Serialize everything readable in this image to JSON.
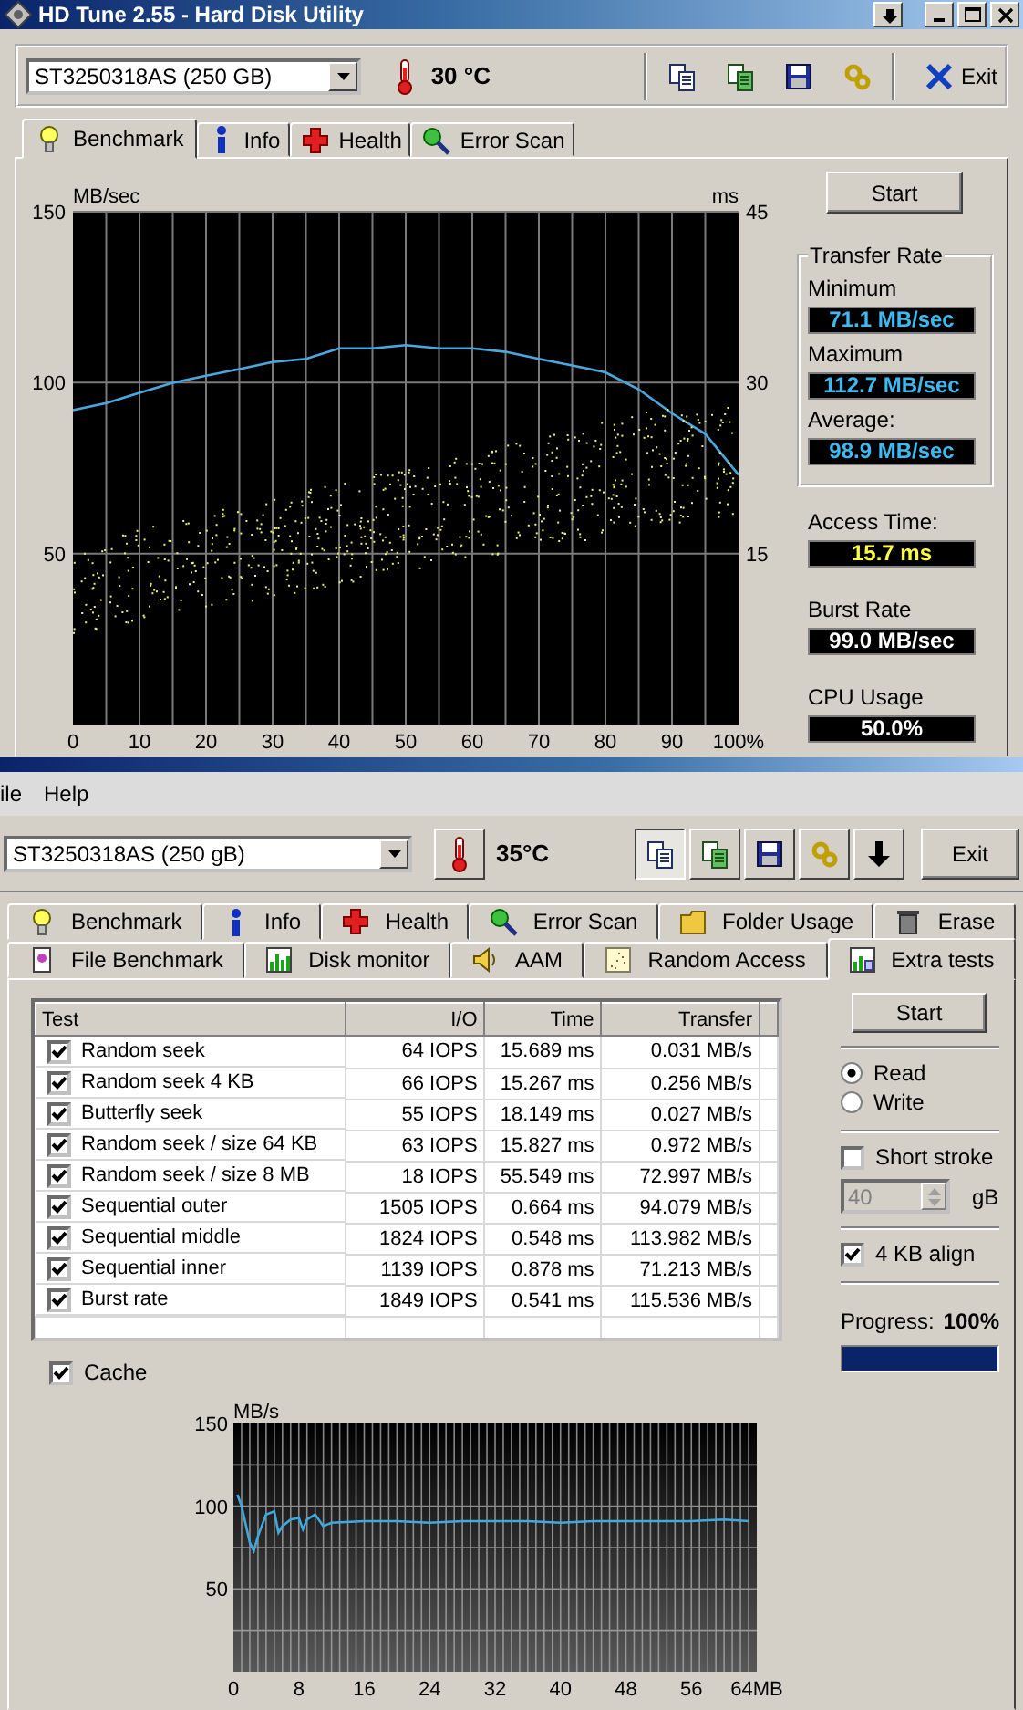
{
  "benchmark_window": {
    "title": "HD Tune 2.55 - Hard Disk Utility",
    "drive": "ST3250318AS (250 GB)",
    "temperature": "30 °C",
    "exit_label": "Exit",
    "tabs": [
      {
        "label": "Benchmark",
        "selected": true
      },
      {
        "label": "Info",
        "selected": false
      },
      {
        "label": "Health",
        "selected": false
      },
      {
        "label": "Error Scan",
        "selected": false
      }
    ],
    "start_label": "Start",
    "chart_data": {
      "type": "line",
      "ylabel": "MB/sec",
      "xlim": [
        0,
        100
      ],
      "ylim": [
        0,
        150
      ],
      "yticks": [
        50,
        100,
        150
      ],
      "xticks": [
        0,
        10,
        20,
        30,
        40,
        50,
        60,
        70,
        80,
        90,
        {
          "value": 100,
          "label": "100%"
        }
      ],
      "x": [
        0,
        5,
        10,
        15,
        20,
        25,
        30,
        35,
        40,
        45,
        50,
        55,
        60,
        65,
        70,
        75,
        80,
        85,
        90,
        95,
        100
      ],
      "grid": true,
      "series": [
        {
          "color": "#4aa8e0",
          "values": [
            92,
            94,
            97,
            100,
            102,
            104,
            106,
            107,
            110,
            110,
            111,
            110,
            110,
            109,
            107,
            105,
            103,
            98,
            91,
            85,
            73
          ]
        }
      ]
    },
    "right_axis": {
      "label": "ms",
      "ticks": [
        "45",
        "30",
        "15"
      ]
    },
    "transfer_rate": {
      "title": "Transfer Rate",
      "readings": [
        {
          "label": "Minimum",
          "value": "71.1 MB/sec"
        },
        {
          "label": "Maximum",
          "value": "112.7 MB/sec"
        },
        {
          "label": "Average:",
          "value": "98.9 MB/sec"
        }
      ]
    },
    "stats": [
      {
        "kind": "time",
        "label": "Access Time:",
        "value": "15.7 ms"
      },
      {
        "kind": "rate",
        "label": "Burst Rate",
        "value": "99.0 MB/sec"
      },
      {
        "kind": "usage",
        "label": "CPU Usage",
        "value": "50.0%"
      }
    ]
  },
  "pro_window": {
    "menu": [
      {
        "label": "ile"
      },
      {
        "label": "Help"
      }
    ],
    "drive": "ST3250318AS (250 gB)",
    "temperature": "35°C",
    "toolbar_buttons": [
      {
        "pressed": true
      },
      {
        "pressed": false
      },
      {
        "pressed": false
      },
      {
        "pressed": false
      },
      {
        "pressed": false
      }
    ],
    "exit_label": "Exit",
    "tab_rows": [
      [
        {
          "label": "Benchmark",
          "selected": false
        },
        {
          "label": "Info",
          "selected": false
        },
        {
          "label": "Health",
          "selected": false
        },
        {
          "label": "Error Scan",
          "selected": false
        },
        {
          "label": "Folder Usage",
          "selected": false
        },
        {
          "label": "Erase",
          "selected": false
        }
      ],
      [
        {
          "label": "File Benchmark",
          "selected": false
        },
        {
          "label": "Disk monitor",
          "selected": false
        },
        {
          "label": "AAM",
          "selected": false
        },
        {
          "label": "Random Access",
          "selected": false
        },
        {
          "label": "Extra tests",
          "selected": true
        }
      ]
    ],
    "table": {
      "columns": [
        "Test",
        "I/O",
        "Time",
        "Transfer"
      ],
      "rows": [
        {
          "checked": true,
          "cells": [
            "Random seek",
            "64 IOPS",
            "15.689 ms",
            "0.031 MB/s"
          ]
        },
        {
          "checked": true,
          "cells": [
            "Random seek 4 KB",
            "66 IOPS",
            "15.267 ms",
            "0.256 MB/s"
          ]
        },
        {
          "checked": true,
          "cells": [
            "Butterfly seek",
            "55 IOPS",
            "18.149 ms",
            "0.027 MB/s"
          ]
        },
        {
          "checked": true,
          "cells": [
            "Random seek / size 64 KB",
            "63 IOPS",
            "15.827 ms",
            "0.972 MB/s"
          ]
        },
        {
          "checked": true,
          "cells": [
            "Random seek / size 8 MB",
            "18 IOPS",
            "55.549 ms",
            "72.997 MB/s"
          ]
        },
        {
          "checked": true,
          "cells": [
            "Sequential outer",
            "1505 IOPS",
            "0.664 ms",
            "94.079 MB/s"
          ]
        },
        {
          "checked": true,
          "cells": [
            "Sequential middle",
            "1824 IOPS",
            "0.548 ms",
            "113.982 MB/s"
          ]
        },
        {
          "checked": true,
          "cells": [
            "Sequential inner",
            "1139 IOPS",
            "0.878 ms",
            "71.213 MB/s"
          ]
        },
        {
          "checked": true,
          "cells": [
            "Burst rate",
            "1849 IOPS",
            "0.541 ms",
            "115.536 MB/s"
          ]
        }
      ]
    },
    "cache": {
      "label": "Cache",
      "checked": true
    },
    "start_label": "Start",
    "modes": [
      {
        "label": "Read",
        "selected": true
      },
      {
        "label": "Write",
        "selected": false
      }
    ],
    "short_stroke": {
      "label": "Short stroke",
      "checked": false,
      "value": "40",
      "unit": "gB",
      "disabled": true
    },
    "align": {
      "label": "4 KB align",
      "checked": true
    },
    "progress": {
      "label": "Progress:",
      "reading": "100%",
      "level": 1
    },
    "chart_data": {
      "type": "line",
      "ylabel": "MB/s",
      "xlim": [
        0,
        64
      ],
      "ylim": [
        0,
        150
      ],
      "yticks": [
        50,
        100,
        150
      ],
      "xticks": [
        0,
        8,
        16,
        24,
        32,
        40,
        48,
        56,
        {
          "value": 64,
          "label": "64MB"
        }
      ],
      "x": [
        0.5,
        1,
        2,
        2.5,
        3,
        4,
        5,
        5.5,
        6,
        7,
        8,
        8.5,
        9,
        10,
        11,
        12,
        16,
        20,
        24,
        28,
        32,
        36,
        40,
        44,
        48,
        52,
        56,
        60,
        63
      ],
      "grid": true,
      "series": [
        {
          "color": "#40a8e0",
          "values": [
            107,
            100,
            78,
            73,
            82,
            95,
            97,
            84,
            88,
            92,
            93,
            86,
            92,
            95,
            88,
            90,
            91,
            91,
            90,
            91,
            91,
            91,
            90,
            91,
            91,
            91,
            91,
            92,
            91
          ]
        }
      ]
    }
  }
}
